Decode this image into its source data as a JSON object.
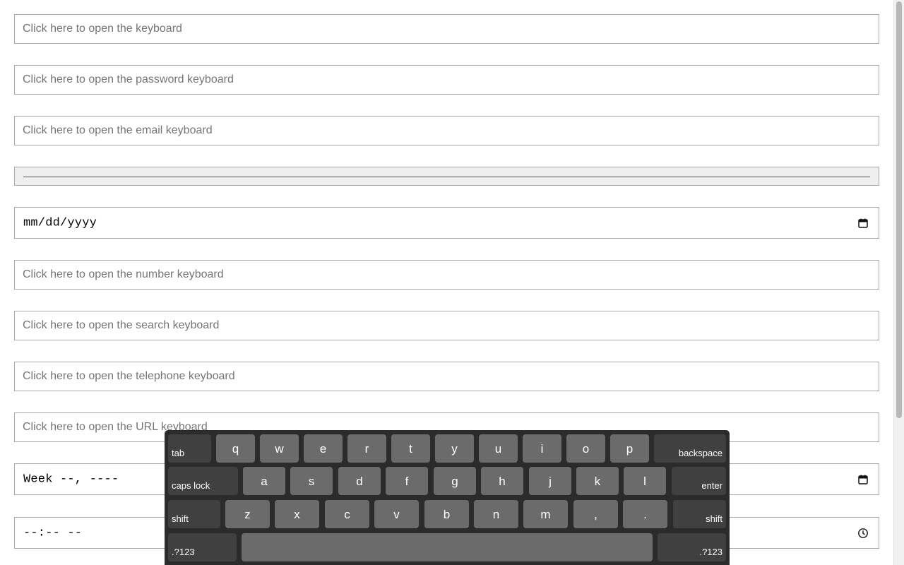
{
  "fields": {
    "text_placeholder": "Click here to open the keyboard",
    "password_placeholder": "Click here to open the password keyboard",
    "email_placeholder": "Click here to open the email keyboard",
    "date_value": "mm/dd/yyyy",
    "number_placeholder": "Click here to open the number keyboard",
    "search_placeholder": "Click here to open the search keyboard",
    "telephone_placeholder": "Click here to open the telephone keyboard",
    "url_placeholder": "Click here to open the URL keyboard",
    "week_value": "Week --, ----",
    "time_value": "--:-- --"
  },
  "keyboard": {
    "row1": [
      "q",
      "w",
      "e",
      "r",
      "t",
      "y",
      "u",
      "i",
      "o",
      "p"
    ],
    "row2": [
      "a",
      "s",
      "d",
      "f",
      "g",
      "h",
      "j",
      "k",
      "l"
    ],
    "row3": [
      "z",
      "x",
      "c",
      "v",
      "b",
      "n",
      "m",
      ",",
      "."
    ],
    "tab": "tab",
    "backspace": "backspace",
    "caps_lock": "caps lock",
    "enter": "enter",
    "shift_left": "shift",
    "shift_right": "shift",
    "symbols_left": ".?123",
    "symbols_right": ".?123"
  },
  "colors": {
    "key": "#6b6b6b",
    "modifier_key": "#404040",
    "keyboard_bg": "#2b2b2b"
  }
}
